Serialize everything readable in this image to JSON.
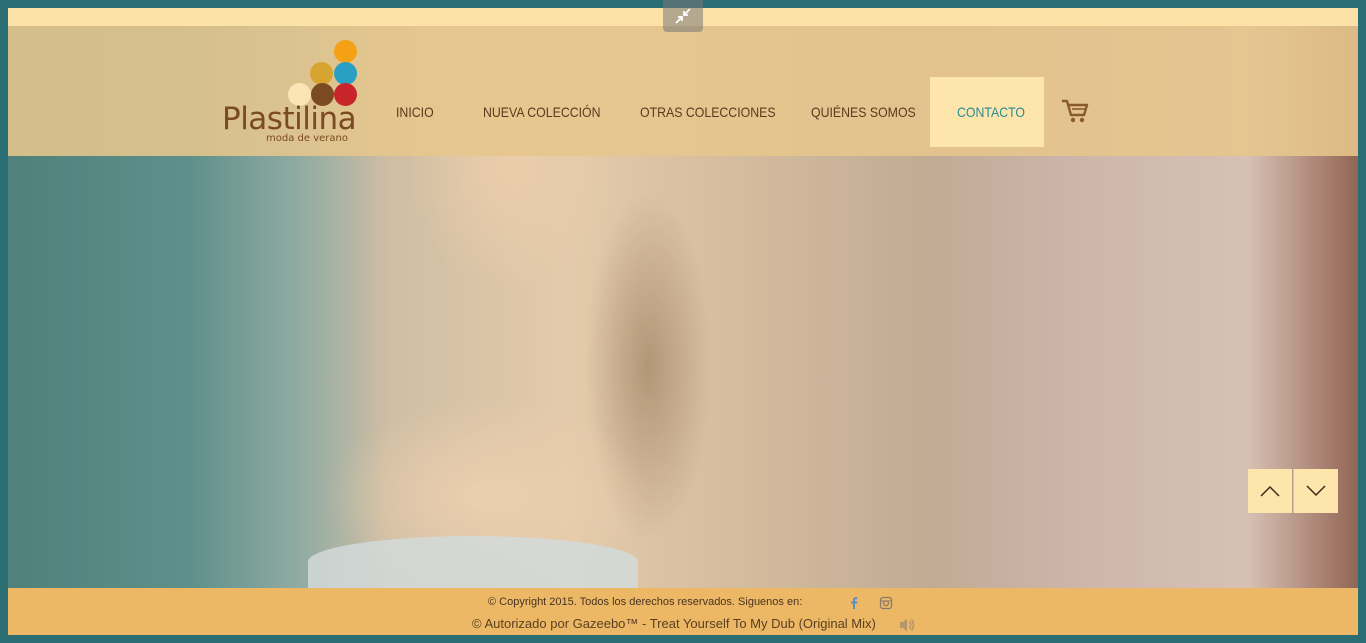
{
  "brand": {
    "name": "Plastilina",
    "tagline": "moda de verano",
    "dot_colors": [
      "#f4a115",
      "#d7a431",
      "#2a9fc4",
      "#fbe4b5",
      "#7b4a22",
      "#c8252a"
    ]
  },
  "nav": {
    "items": [
      {
        "label": "INICIO"
      },
      {
        "label": "NUEVA COLECCIÓN"
      },
      {
        "label": "OTRAS COLECCIONES"
      },
      {
        "label": "QUIÉNES SOMOS"
      },
      {
        "label": "CONTACTO",
        "active": true
      }
    ],
    "active_color": "#2b8a95",
    "cart_icon": "shopping-cart-icon"
  },
  "controls": {
    "collapse_icon": "collapse-arrows-icon",
    "prev_icon": "chevron-up-icon",
    "next_icon": "chevron-down-icon"
  },
  "footer": {
    "copyright": "© Copyright 2015. Todos los derechos reservados. Siguenos en:",
    "social": [
      "facebook-icon",
      "instagram-icon"
    ],
    "track": "© Autorizado por Gazeebo™ - Treat Yourself To My Dub (Original Mix)",
    "audio_icon": "speaker-icon"
  },
  "colors": {
    "header_bg": "#e6c68c",
    "footer_bg": "#ecb865",
    "accent": "#fde5ab"
  }
}
